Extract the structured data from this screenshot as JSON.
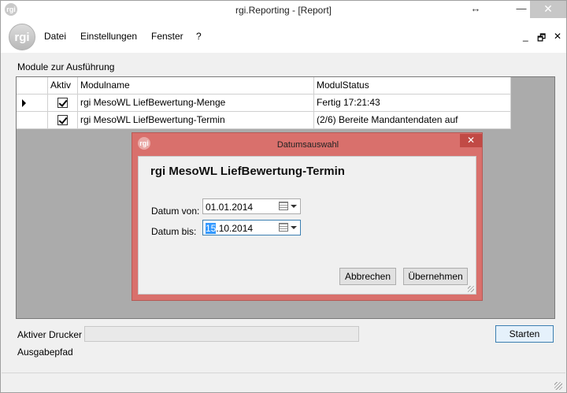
{
  "window": {
    "title": "rgi.Reporting - [Report]",
    "icon_text": "rgi",
    "controls": {
      "restore": "↔",
      "minimize": "—",
      "maximize": "☐",
      "close": "✕"
    }
  },
  "menu": {
    "logo_text": "rgi",
    "items": [
      {
        "label": "Datei"
      },
      {
        "label": "Einstellungen"
      },
      {
        "label": "Fenster"
      },
      {
        "label": "?"
      }
    ],
    "mdi_controls": {
      "minimize": "_",
      "restore": "🗗",
      "close": "✕"
    }
  },
  "main": {
    "section_label": "Module zur Ausführung",
    "grid": {
      "columns": [
        "Aktiv",
        "Modulname",
        "ModulStatus"
      ],
      "rows": [
        {
          "active": true,
          "name": "rgi MesoWL LiefBewertung-Menge",
          "status": "Fertig 17:21:43",
          "current": true
        },
        {
          "active": true,
          "name": "rgi MesoWL LiefBewertung-Termin",
          "status": "(2/6) Bereite Mandantendaten auf",
          "current": false
        }
      ]
    },
    "printer_label": "Aktiver Drucker",
    "printer_value": "",
    "output_label": "Ausgabepfad",
    "start_button": "Starten"
  },
  "dialog": {
    "title": "Datumsauswahl",
    "icon_text": "rgi",
    "close": "✕",
    "heading": "rgi MesoWL LiefBewertung-Termin",
    "date_from_label": "Datum von:",
    "date_from_value": "01.01.2014",
    "date_to_label": "Datum bis:",
    "date_to_selected": "15",
    "date_to_rest": ".10.2014",
    "cancel_button": "Abbrechen",
    "accept_button": "Übernehmen"
  },
  "colors": {
    "dialog_frame": "#d9706c",
    "grid_background": "#ababab",
    "selection": "#3399ff"
  }
}
